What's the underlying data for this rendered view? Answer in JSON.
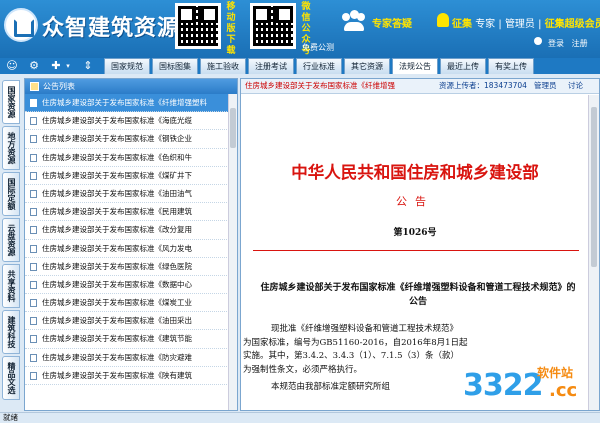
{
  "header": {
    "logo_text": "众智建筑资源",
    "mobile_label": "移动版下载",
    "wechat_label": "微信公众号",
    "free_call": "免费公测",
    "expert_qa": "专家答疑",
    "links": [
      "征集",
      "专家",
      "管理员",
      "征集超级会员"
    ],
    "login": "登录",
    "register": "注册"
  },
  "tabs": [
    "国家规范",
    "国标图集",
    "施工验收",
    "注册考试",
    "行业标准",
    "其它资源",
    "法规公告",
    "最近上传",
    "有奖上传"
  ],
  "active_tab": 6,
  "vertical_tabs": [
    "国家资源",
    "地方资源",
    "国际定额",
    "云盘资源",
    "共享资料",
    "建筑科技",
    "精品文选"
  ],
  "active_vertical_tab": 0,
  "list": {
    "header": "公告列表",
    "items": [
      "住房城乡建设部关于发布国家标准《纤维增强塑料",
      "住房城乡建设部关于发布国家标准《海底光缆",
      "住房城乡建设部关于发布国家标准《钢铁企业",
      "住房城乡建设部关于发布国家标准《色织和牛",
      "住房城乡建设部关于发布国家标准《煤矿井下",
      "住房城乡建设部关于发布国家标准《油田油气",
      "住房城乡建设部关于发布国家标准《民用建筑",
      "住房城乡建设部关于发布国家标准《改分复用",
      "住房城乡建设部关于发布国家标准《风力发电",
      "住房城乡建设部关于发布国家标准《绿色医院",
      "住房城乡建设部关于发布国家标准《数据中心",
      "住房城乡建设部关于发布国家标准《煤炭工业",
      "住房城乡建设部关于发布国家标准《油田采出",
      "住房城乡建设部关于发布国家标准《建筑节能",
      "住房城乡建设部关于发布国家标准《防灾避难",
      "住房城乡建设部关于发布国家标准《陕有建筑"
    ],
    "selected": 0
  },
  "doc": {
    "crumb": "住房城乡建设部关于发布国家标准《纤维增强",
    "uploader": "资源上传者：183473704",
    "admin": "管理员",
    "discuss": "讨论",
    "ministry": "中华人民共和国住房和城乡建设部",
    "notice": "公告",
    "number": "第1026号",
    "title": "住房城乡建设部关于发布国家标准《纤维增强塑料设备和管道工程技术规范》的公告",
    "para": [
      "现批准《纤维增强塑料设备和管道工程技术规范》",
      "为国家标准，编号为GB51160-2016，自2016年8月1日起",
      "实施。其中，第3.4.2、3.4.3（1）、7.1.5（3）条（款）",
      "为强制性条文，必须严格执行。",
      "本规范由我部标准定额研究所组"
    ]
  },
  "status": "就绪",
  "watermark": {
    "num": "3322",
    "cc": ".cc",
    "soft": "软件站"
  }
}
